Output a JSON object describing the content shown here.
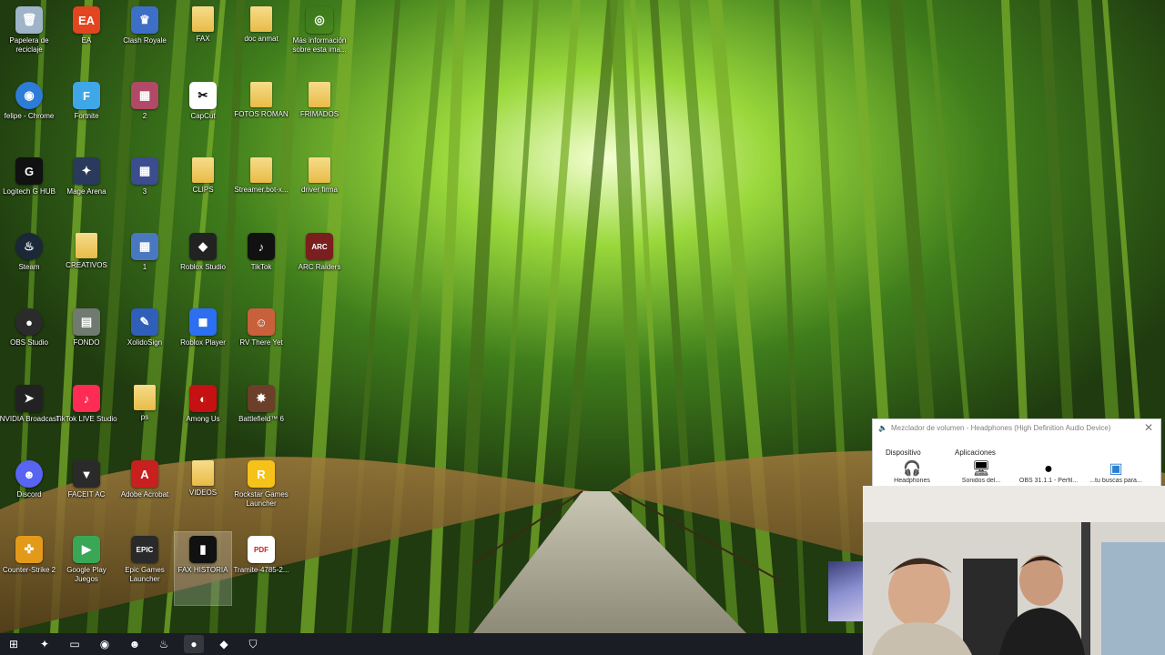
{
  "desktop": {
    "icons": [
      {
        "label": "Papelera de reciclaje",
        "icon": "recycle-bin-icon",
        "glyph": "🗑",
        "bg": "#9fb4c8"
      },
      {
        "label": "EA",
        "icon": "ea-icon",
        "glyph": "EA",
        "bg": "#e2451f"
      },
      {
        "label": "Clash Royale",
        "icon": "clash-royale-icon",
        "glyph": "♛",
        "bg": "#3e6fc7"
      },
      {
        "label": "FAX",
        "icon": "folder-icon",
        "glyph": "",
        "bg": ""
      },
      {
        "label": "doc anmat",
        "icon": "folder-icon",
        "glyph": "",
        "bg": ""
      },
      {
        "label": "Más información sobre esta ima...",
        "icon": "info-camera-icon",
        "glyph": "◎",
        "bg": "transparent"
      },
      {
        "label": "felipe - Chrome",
        "icon": "chrome-icon",
        "glyph": "◉",
        "bg": "#2e7cd6"
      },
      {
        "label": "Fortnite",
        "icon": "fortnite-icon",
        "glyph": "F",
        "bg": "#3fa6e8"
      },
      {
        "label": "2",
        "icon": "file-image-icon",
        "glyph": "▦",
        "bg": "#b04a66"
      },
      {
        "label": "CapCut",
        "icon": "capcut-icon",
        "glyph": "✂",
        "bg": "#ffffff"
      },
      {
        "label": "FOTOS ROMAN",
        "icon": "folder-icon",
        "glyph": "",
        "bg": ""
      },
      {
        "label": "FRIMADOS",
        "icon": "folder-icon",
        "glyph": "",
        "bg": ""
      },
      {
        "label": "Logitech G HUB",
        "icon": "logitech-icon",
        "glyph": "G",
        "bg": "#111111"
      },
      {
        "label": "Mage Arena",
        "icon": "mage-arena-icon",
        "glyph": "✦",
        "bg": "#2a3a5c"
      },
      {
        "label": "3",
        "icon": "file-image-icon",
        "glyph": "▦",
        "bg": "#3b4d8f"
      },
      {
        "label": "CLIPS",
        "icon": "folder-icon",
        "glyph": "",
        "bg": ""
      },
      {
        "label": "Streamer.bot-x...",
        "icon": "folder-icon",
        "glyph": "",
        "bg": ""
      },
      {
        "label": "driver firma",
        "icon": "folder-icon",
        "glyph": "",
        "bg": ""
      },
      {
        "label": "Steam",
        "icon": "steam-icon",
        "glyph": "♨",
        "bg": "#1b2838"
      },
      {
        "label": "CREATIVOS",
        "icon": "folder-icon",
        "glyph": "",
        "bg": ""
      },
      {
        "label": "1",
        "icon": "file-image-icon",
        "glyph": "▦",
        "bg": "#4a78c0"
      },
      {
        "label": "Roblox Studio",
        "icon": "roblox-studio-icon",
        "glyph": "◆",
        "bg": "#222222"
      },
      {
        "label": "TikTok",
        "icon": "tiktok-icon",
        "glyph": "♪",
        "bg": "#111111"
      },
      {
        "label": "ARC Raiders",
        "icon": "arc-raiders-icon",
        "glyph": "ARC",
        "bg": "#7a1e1e"
      },
      {
        "label": "OBS Studio",
        "icon": "obs-icon",
        "glyph": "●",
        "bg": "#2b2b2b"
      },
      {
        "label": "FONDO",
        "icon": "file-image-icon",
        "glyph": "▤",
        "bg": "#707a70"
      },
      {
        "label": "XolidoSign",
        "icon": "xolidosign-icon",
        "glyph": "✎",
        "bg": "#2f5fb8"
      },
      {
        "label": "Roblox Player",
        "icon": "roblox-player-icon",
        "glyph": "◼",
        "bg": "#2c6ff0"
      },
      {
        "label": "RV There Yet",
        "icon": "rv-there-yet-icon",
        "glyph": "☺",
        "bg": "#c9603c"
      },
      {
        "label": "",
        "icon": "",
        "glyph": "",
        "bg": ""
      },
      {
        "label": "NVIDIA Broadcast",
        "icon": "nvidia-icon",
        "glyph": "➤",
        "bg": "#222222"
      },
      {
        "label": "TikTok LIVE Studio",
        "icon": "tiktok-live-icon",
        "glyph": "♪",
        "bg": "#fe2c55"
      },
      {
        "label": "ps",
        "icon": "folder-icon",
        "glyph": "",
        "bg": ""
      },
      {
        "label": "Among Us",
        "icon": "among-us-icon",
        "glyph": "◐",
        "bg": "#c51111"
      },
      {
        "label": "Battlefield™ 6",
        "icon": "battlefield-icon",
        "glyph": "✸",
        "bg": "#6b3f2a"
      },
      {
        "label": "",
        "icon": "",
        "glyph": "",
        "bg": ""
      },
      {
        "label": "Discord",
        "icon": "discord-icon",
        "glyph": "☻",
        "bg": "#5865f2"
      },
      {
        "label": "FACEIT AC",
        "icon": "faceit-icon",
        "glyph": "▼",
        "bg": "#2a2a2a"
      },
      {
        "label": "Adobe Acrobat",
        "icon": "acrobat-icon",
        "glyph": "A",
        "bg": "#c8201e"
      },
      {
        "label": "VIDEOS",
        "icon": "folder-icon",
        "glyph": "",
        "bg": ""
      },
      {
        "label": "Rockstar Games Launcher",
        "icon": "rockstar-icon",
        "glyph": "R",
        "bg": "#f6c21a"
      },
      {
        "label": "",
        "icon": "",
        "glyph": "",
        "bg": ""
      },
      {
        "label": "Counter-Strike 2",
        "icon": "cs2-icon",
        "glyph": "✜",
        "bg": "#e39a1b"
      },
      {
        "label": "Google Play Juegos",
        "icon": "google-play-games-icon",
        "glyph": "▶",
        "bg": "#3aa757"
      },
      {
        "label": "Epic Games Launcher",
        "icon": "epic-games-icon",
        "glyph": "EPIC",
        "bg": "#2a2a2a"
      },
      {
        "label": "FAX HISTORIA",
        "icon": "file-image-icon",
        "glyph": "▮",
        "bg": "#111111"
      },
      {
        "label": "Tramite-4785-2...",
        "icon": "pdf-icon",
        "glyph": "PDF",
        "bg": "#ffffff"
      },
      {
        "label": "",
        "icon": "",
        "glyph": "",
        "bg": ""
      }
    ]
  },
  "mixer": {
    "title": "Mezclador de volumen - Headphones (High Definition Audio Device)",
    "device_label": "Dispositivo",
    "apps_label": "Aplicaciones",
    "close": "✕",
    "entries": [
      {
        "name": "Headphones",
        "glyph": "🎧",
        "icon": "headphones-icon"
      },
      {
        "name": "Sonidos del...",
        "glyph": "🖥",
        "icon": "system-sounds-icon"
      },
      {
        "name": "OBS 31.1.1 - Perfil...",
        "glyph": "●",
        "icon": "obs-icon"
      },
      {
        "name": "...tu buscas para...",
        "glyph": "▣",
        "icon": "app-window-icon"
      }
    ]
  },
  "taskbar": {
    "items": [
      {
        "icon": "windows-start-icon",
        "glyph": "⊞"
      },
      {
        "icon": "copilot-icon",
        "glyph": "✦"
      },
      {
        "icon": "file-explorer-icon",
        "glyph": "▭"
      },
      {
        "icon": "chrome-icon",
        "glyph": "◉"
      },
      {
        "icon": "discord-icon",
        "glyph": "☻"
      },
      {
        "icon": "steam-icon",
        "glyph": "♨"
      },
      {
        "icon": "obs-icon",
        "glyph": "●"
      },
      {
        "icon": "app-diamond-icon",
        "glyph": "◆"
      },
      {
        "icon": "app-shield-icon",
        "glyph": "⛉"
      }
    ]
  },
  "colors": {
    "folder": "#e8bb47",
    "taskbar": "#1b1d24",
    "label_text": "#ffffff"
  }
}
